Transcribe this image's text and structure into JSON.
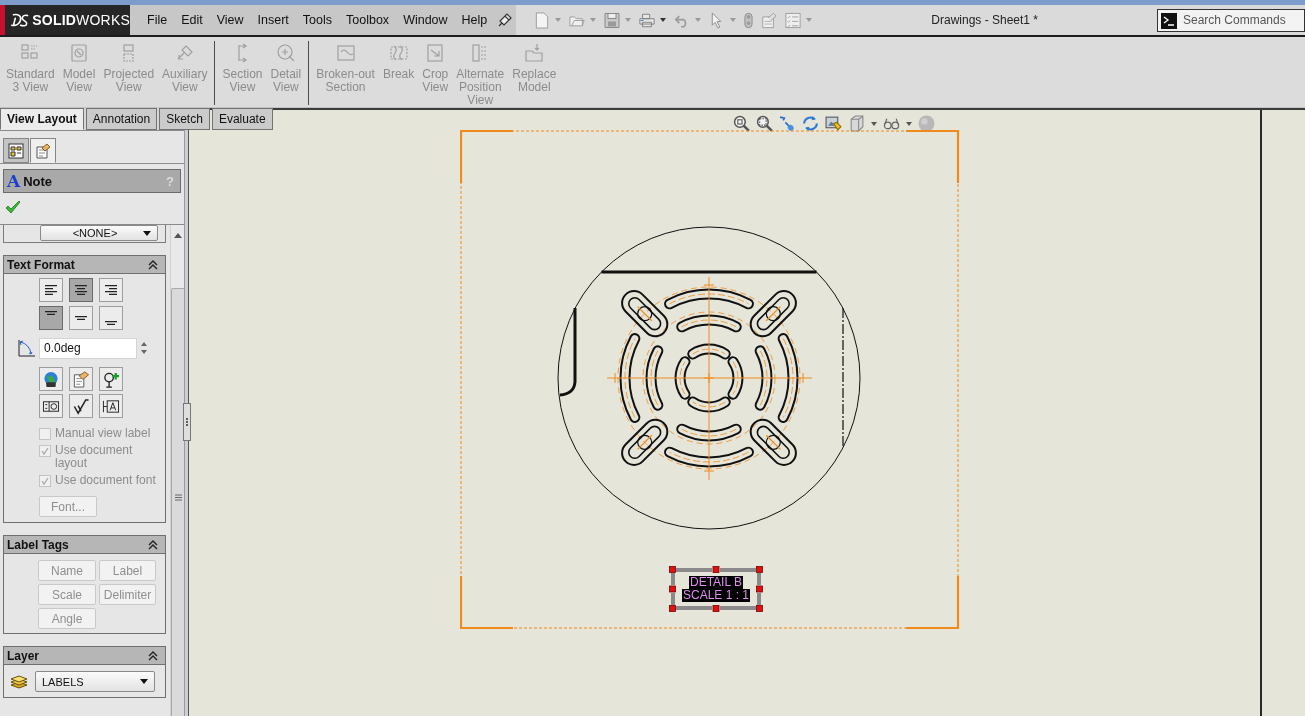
{
  "menu_bar": {
    "logo": "**SOLID**WORKS",
    "items": [
      "File",
      "Edit",
      "View",
      "Insert",
      "Tools",
      "Toolbox",
      "Window",
      "Help"
    ]
  },
  "window_title": "Drawings - Sheet1 *",
  "search": {
    "placeholder": "Search Commands"
  },
  "command_groups": [
    {
      "commands": [
        {
          "label": "Standard\n3 View",
          "disabled": true
        },
        {
          "label": "Model\nView",
          "disabled": true
        },
        {
          "label": "Projected\nView",
          "disabled": true
        },
        {
          "label": "Auxiliary\nView",
          "disabled": true
        }
      ]
    },
    {
      "commands": [
        {
          "label": "Section\nView",
          "disabled": true
        },
        {
          "label": "Detail\nView",
          "disabled": true
        }
      ]
    },
    {
      "commands": [
        {
          "label": "Broken-out\nSection",
          "disabled": true
        },
        {
          "label": "Break",
          "disabled": true
        },
        {
          "label": "Crop\nView",
          "disabled": true
        },
        {
          "label": "Alternate\nPosition\nView",
          "disabled": true
        },
        {
          "label": "Replace\nModel",
          "disabled": true
        }
      ]
    }
  ],
  "tabs": [
    {
      "label": "View Layout",
      "selected": true
    },
    {
      "label": "Annotation",
      "selected": false
    },
    {
      "label": "Sketch",
      "selected": false
    },
    {
      "label": "Evaluate",
      "selected": false
    }
  ],
  "property_manager": {
    "panel_tabs": [
      {
        "selected": false
      },
      {
        "selected": true
      }
    ],
    "title_glyph": "A",
    "title": "Note",
    "help": "?",
    "style_dropdown": {
      "value": "<NONE>"
    },
    "text_format": {
      "title": "Text Format",
      "expanded": true,
      "justify_buttons": [
        {
          "selected": false
        },
        {
          "selected": true
        },
        {
          "selected": false
        }
      ],
      "vertical_buttons": [
        {
          "selected": true
        },
        {
          "selected": false
        },
        {
          "selected": false
        }
      ],
      "angle": {
        "value": "0.0deg"
      },
      "checkboxes": [
        {
          "label": "Manual view label",
          "checked": false,
          "disabled": true
        },
        {
          "label": "Use document layout",
          "checked": true,
          "disabled": true
        },
        {
          "label": "Use document font",
          "checked": true,
          "disabled": true
        }
      ],
      "font_button": {
        "label": "Font...",
        "disabled": true
      }
    },
    "label_tags": {
      "title": "Label Tags",
      "expanded": true,
      "buttons": [
        {
          "label": "Name",
          "disabled": true
        },
        {
          "label": "Label",
          "disabled": true
        },
        {
          "label": "Scale",
          "disabled": true
        },
        {
          "label": "Delimiter",
          "disabled": true
        },
        {
          "label": "Angle",
          "disabled": true
        }
      ]
    },
    "layer": {
      "title": "Layer",
      "expanded": true,
      "dropdown": {
        "value": "LABELS"
      }
    }
  },
  "drawing": {
    "view_label": {
      "lines": [
        "DETAIL B",
        "SCALE 1 : 1"
      ],
      "selected": true
    }
  }
}
